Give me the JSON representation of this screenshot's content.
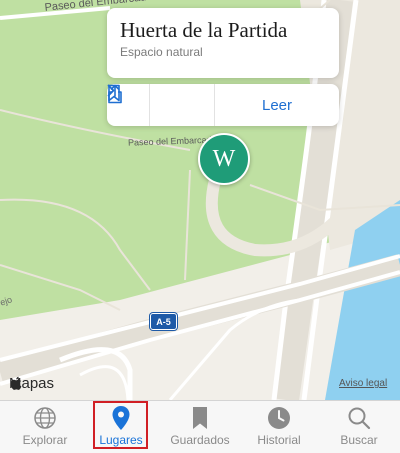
{
  "map": {
    "street_top": "Paseo del Embarcadero",
    "street_pin": "Paseo del Embarcadero",
    "edge_label": "ejo",
    "road_shield": "A-5",
    "attribution": "Mapas",
    "legal": "Aviso legal",
    "colors": {
      "park": "#bfe0a2",
      "land": "#f2efe9",
      "water": "#8fd0f0",
      "road": "#ffffff",
      "pin": "#1f9c78"
    }
  },
  "pin": {
    "glyph": "W",
    "icon": "wikipedia-icon"
  },
  "place_card": {
    "title": "Huerta de la Partida",
    "subtitle": "Espacio natural",
    "read_label": "Leer",
    "icons": [
      "bookmark-icon",
      "share-icon",
      "chevron-right-icon"
    ]
  },
  "tabbar": {
    "active_color": "#1a73d8",
    "highlight_color": "#d11f25",
    "tabs": [
      {
        "label": "Explorar",
        "icon": "globe-icon"
      },
      {
        "label": "Lugares",
        "icon": "location-pin-icon",
        "active": true
      },
      {
        "label": "Guardados",
        "icon": "bookmark-icon"
      },
      {
        "label": "Historial",
        "icon": "clock-icon"
      },
      {
        "label": "Buscar",
        "icon": "search-icon"
      }
    ]
  }
}
